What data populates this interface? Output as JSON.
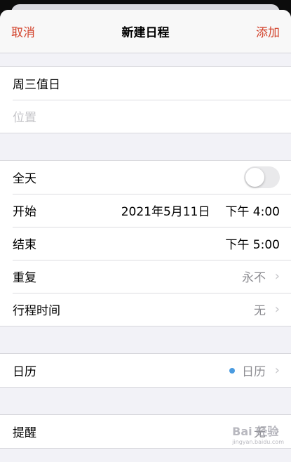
{
  "nav": {
    "cancel": "取消",
    "title": "新建日程",
    "add": "添加"
  },
  "event": {
    "title": "周三值日",
    "location_placeholder": "位置"
  },
  "timing": {
    "allday_label": "全天",
    "allday_on": false,
    "start_label": "开始",
    "start_date": "2021年5月11日",
    "start_time": "下午 4:00",
    "end_label": "结束",
    "end_time": "下午 5:00",
    "repeat_label": "重复",
    "repeat_value": "永不",
    "travel_label": "行程时间",
    "travel_value": "无"
  },
  "calendar": {
    "label": "日历",
    "value": "日历",
    "dot_color": "#4a9be0"
  },
  "alert": {
    "label": "提醒",
    "value": "无"
  },
  "watermark": {
    "text": "Bai 经验",
    "sub": "jingyan.baidu.com"
  },
  "colors": {
    "accent": "#d3452e"
  }
}
